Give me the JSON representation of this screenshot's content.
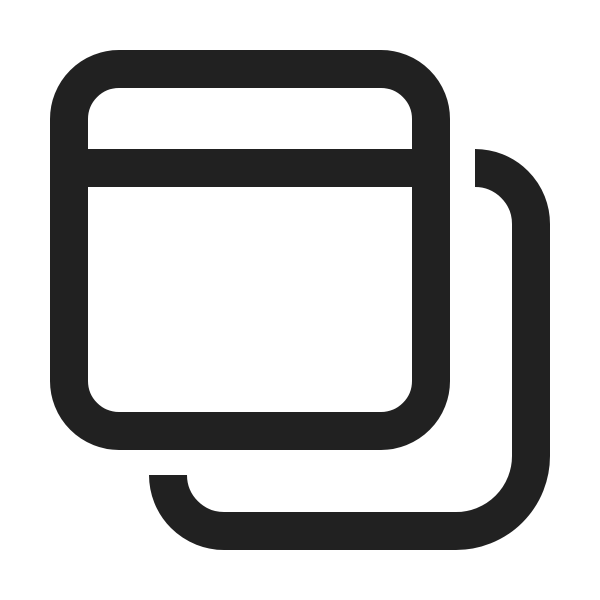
{
  "icon": {
    "name": "windows-stacked-icon",
    "stroke_color": "#212121",
    "background_color": "#ffffff"
  }
}
